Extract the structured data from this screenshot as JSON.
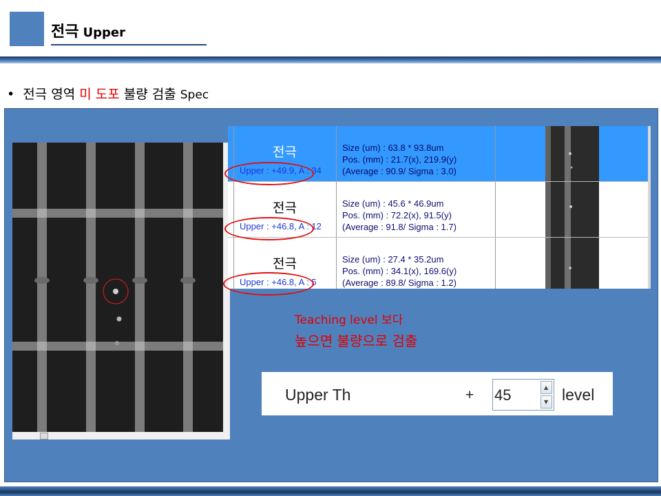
{
  "slide": {
    "title": "전극",
    "title_sub": "Upper",
    "bullet_prefix": "전극 영역 ",
    "bullet_red": "미 도포",
    "bullet_suffix": " 불량 검출 ",
    "bullet_spec": "Spec"
  },
  "defect_list": {
    "rows": [
      {
        "label": "전극",
        "upper": "Upper : +49.9, A : 34",
        "size": "Size (um) : 63.8 * 93.8um",
        "pos": "Pos. (mm) : 21.7(x), 219.9(y)",
        "avg": "(Average : 90.9/ Sigma : 3.0)",
        "selected": true
      },
      {
        "label": "전극",
        "upper": "Upper : +46.8, A : 12",
        "size": "Size (um) : 45.6 * 46.9um",
        "pos": "Pos. (mm) : 72.2(x), 91.5(y)",
        "avg": "(Average : 91.8/ Sigma : 1.7)",
        "selected": false
      },
      {
        "label": "전극",
        "upper": "Upper : +46.8, A : 5",
        "size": "Size (um) : 27.4 * 35.2um",
        "pos": "Pos. (mm) : 34.1(x), 169.6(y)",
        "avg": "(Average : 89.8/ Sigma : 1.2)",
        "selected": false
      }
    ]
  },
  "note": {
    "line1": "Teaching level 보다",
    "line2": "높으면 불량으로 검출"
  },
  "setting": {
    "label": "Upper Th",
    "plus": "+",
    "value": "45",
    "unit": "level"
  },
  "colors": {
    "panel": "#4f81bd",
    "accent_red": "#e00000",
    "selected_row": "#3399ff"
  }
}
